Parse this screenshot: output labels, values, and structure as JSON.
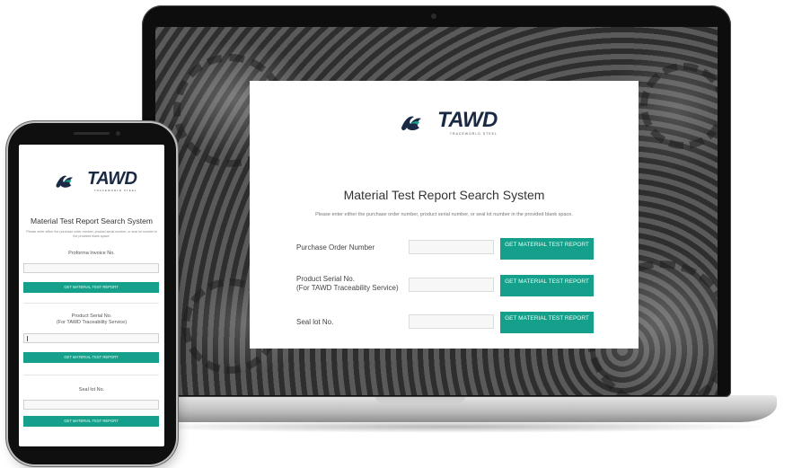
{
  "brand": {
    "name": "TAWD",
    "tagline": "TRACEWORLD STEEL",
    "mark_color": "#1b2a44",
    "accent": "#14a08a"
  },
  "desktop": {
    "title": "Material Test Report Search System",
    "subtitle": "Please enter either the purchase order number, product serial number, or seal lot number in the provided blank space.",
    "rows": [
      {
        "label": "Purchase Order Number",
        "input_value": "",
        "button": "GET MATERIAL TEST REPORT"
      },
      {
        "label": "Product Serial No.",
        "label_line2": "(For TAWD Traceability Service)",
        "input_value": "",
        "button": "GET MATERIAL TEST REPORT"
      },
      {
        "label": "Seal lot No.",
        "input_value": "",
        "button": "GET MATERIAL TEST REPORT"
      }
    ]
  },
  "mobile": {
    "title": "Material Test Report Search System",
    "subtitle": "Please enter either the purchase order number, product serial number, or seal lot number in the provided blank space.",
    "sections": [
      {
        "label": "Proforma Invoice No.",
        "input_value": "",
        "button": "GET MATERIAL TEST REPORT"
      },
      {
        "label": "Product Serial No.",
        "label_line2": "(For TAWD Traceability Service)",
        "input_value": "",
        "button": "GET MATERIAL TEST REPORT"
      },
      {
        "label": "Seal lot No.",
        "input_value": "",
        "button": "GET MATERIAL TEST REPORT"
      }
    ]
  }
}
